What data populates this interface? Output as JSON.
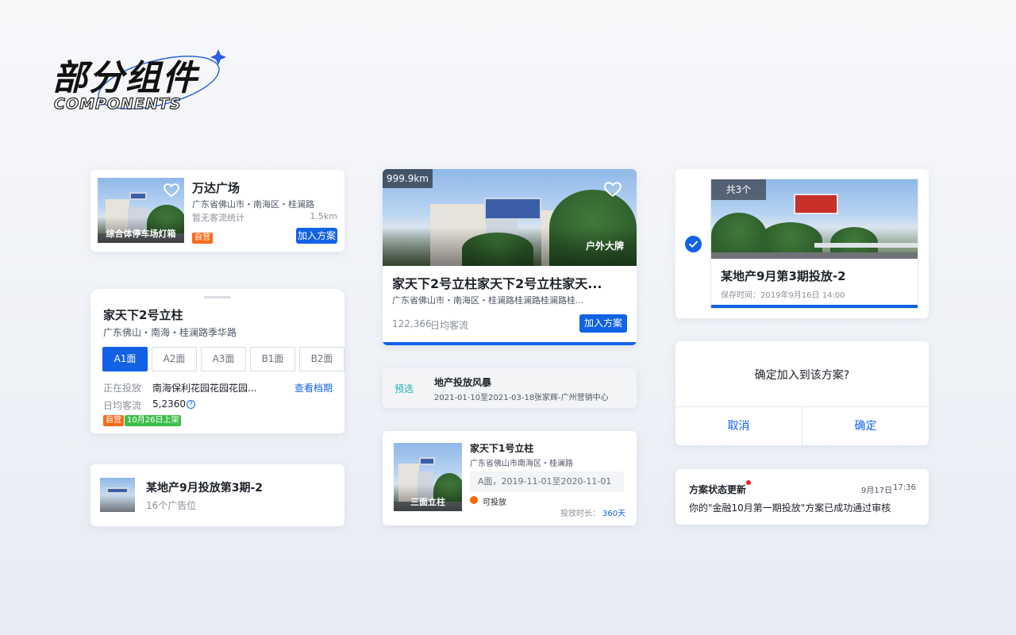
{
  "header": {
    "title": "部分组件",
    "subtitle": "COMPONENTS"
  },
  "card1": {
    "title": "万达广场",
    "address": "广东省佛山市・南海区・桂澜路",
    "traffic": "暂无客流统计",
    "distance": "1.5km",
    "photo_caption": "综合体停车场灯箱",
    "tag": "自营",
    "button": "加入方案"
  },
  "card2": {
    "title": "家天下2号立柱",
    "address": "广东佛山・南海・桂澜路季华路",
    "faces": [
      "A1面",
      "A2面",
      "A3面",
      "B1面",
      "B2面"
    ],
    "status_label": "正在投放",
    "status_value": "南海保利花园花园花园...",
    "link": "查看档期",
    "traffic_label": "日均客流",
    "traffic_value": "5,2360",
    "help_icon": "?",
    "tags": [
      "自营",
      "10月26日上架"
    ]
  },
  "card3": {
    "title": "某地产9月投放第3期-2",
    "subtitle": "16个广告位"
  },
  "card4": {
    "distance": "999.9km",
    "photo_caption": "户外大牌",
    "title": "家天下2号立柱家天下2号立柱家天...",
    "address": "广东省佛山市・南海区・桂澜路桂澜路桂澜路桂...",
    "traffic_value": "122,366",
    "traffic_label": "日均客流",
    "button": "加入方案",
    "accent": "#1262e6"
  },
  "card5": {
    "status": "预选",
    "title": "地产投放风暴",
    "dates": "2021-01-10至2021-03-18",
    "owner": "张家辉-广州营销中心"
  },
  "card6": {
    "title": "家天下1号立柱",
    "address": "广东省佛山市南海区・桂澜路",
    "photo_caption": "三面立柱",
    "period": "A面，2019-11-01至2020-11-01",
    "state": "可投放",
    "duration_label": "投放时长：",
    "duration_value": "360天"
  },
  "card7": {
    "count_badge": "共3个",
    "title": "某地产9月第3期投放-2",
    "saved": "保存时间：2019年9月16日  14:00"
  },
  "card8": {
    "question": "确定加入到该方案?",
    "cancel": "取消",
    "confirm": "确定"
  },
  "card9": {
    "title": "方案状态更新",
    "date": "9月17日",
    "time": "17:36",
    "message": "你的\"金融10月第一期投放\"方案已成功通过审核"
  }
}
